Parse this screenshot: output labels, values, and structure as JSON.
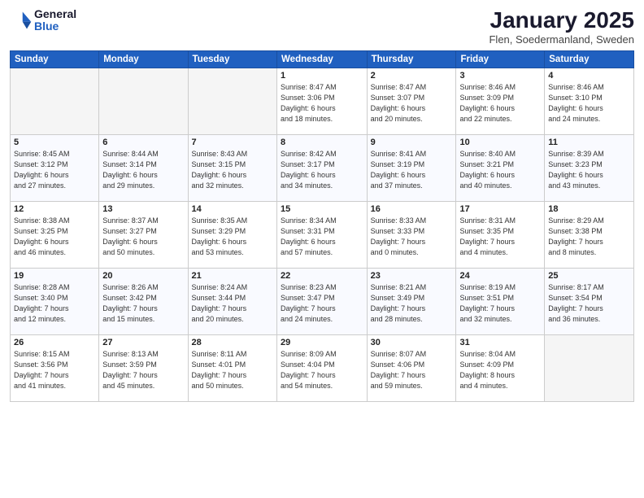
{
  "logo": {
    "general": "General",
    "blue": "Blue"
  },
  "title": "January 2025",
  "location": "Flen, Soedermanland, Sweden",
  "days_of_week": [
    "Sunday",
    "Monday",
    "Tuesday",
    "Wednesday",
    "Thursday",
    "Friday",
    "Saturday"
  ],
  "weeks": [
    [
      {
        "day": "",
        "info": ""
      },
      {
        "day": "",
        "info": ""
      },
      {
        "day": "",
        "info": ""
      },
      {
        "day": "1",
        "info": "Sunrise: 8:47 AM\nSunset: 3:06 PM\nDaylight: 6 hours\nand 18 minutes."
      },
      {
        "day": "2",
        "info": "Sunrise: 8:47 AM\nSunset: 3:07 PM\nDaylight: 6 hours\nand 20 minutes."
      },
      {
        "day": "3",
        "info": "Sunrise: 8:46 AM\nSunset: 3:09 PM\nDaylight: 6 hours\nand 22 minutes."
      },
      {
        "day": "4",
        "info": "Sunrise: 8:46 AM\nSunset: 3:10 PM\nDaylight: 6 hours\nand 24 minutes."
      }
    ],
    [
      {
        "day": "5",
        "info": "Sunrise: 8:45 AM\nSunset: 3:12 PM\nDaylight: 6 hours\nand 27 minutes."
      },
      {
        "day": "6",
        "info": "Sunrise: 8:44 AM\nSunset: 3:14 PM\nDaylight: 6 hours\nand 29 minutes."
      },
      {
        "day": "7",
        "info": "Sunrise: 8:43 AM\nSunset: 3:15 PM\nDaylight: 6 hours\nand 32 minutes."
      },
      {
        "day": "8",
        "info": "Sunrise: 8:42 AM\nSunset: 3:17 PM\nDaylight: 6 hours\nand 34 minutes."
      },
      {
        "day": "9",
        "info": "Sunrise: 8:41 AM\nSunset: 3:19 PM\nDaylight: 6 hours\nand 37 minutes."
      },
      {
        "day": "10",
        "info": "Sunrise: 8:40 AM\nSunset: 3:21 PM\nDaylight: 6 hours\nand 40 minutes."
      },
      {
        "day": "11",
        "info": "Sunrise: 8:39 AM\nSunset: 3:23 PM\nDaylight: 6 hours\nand 43 minutes."
      }
    ],
    [
      {
        "day": "12",
        "info": "Sunrise: 8:38 AM\nSunset: 3:25 PM\nDaylight: 6 hours\nand 46 minutes."
      },
      {
        "day": "13",
        "info": "Sunrise: 8:37 AM\nSunset: 3:27 PM\nDaylight: 6 hours\nand 50 minutes."
      },
      {
        "day": "14",
        "info": "Sunrise: 8:35 AM\nSunset: 3:29 PM\nDaylight: 6 hours\nand 53 minutes."
      },
      {
        "day": "15",
        "info": "Sunrise: 8:34 AM\nSunset: 3:31 PM\nDaylight: 6 hours\nand 57 minutes."
      },
      {
        "day": "16",
        "info": "Sunrise: 8:33 AM\nSunset: 3:33 PM\nDaylight: 7 hours\nand 0 minutes."
      },
      {
        "day": "17",
        "info": "Sunrise: 8:31 AM\nSunset: 3:35 PM\nDaylight: 7 hours\nand 4 minutes."
      },
      {
        "day": "18",
        "info": "Sunrise: 8:29 AM\nSunset: 3:38 PM\nDaylight: 7 hours\nand 8 minutes."
      }
    ],
    [
      {
        "day": "19",
        "info": "Sunrise: 8:28 AM\nSunset: 3:40 PM\nDaylight: 7 hours\nand 12 minutes."
      },
      {
        "day": "20",
        "info": "Sunrise: 8:26 AM\nSunset: 3:42 PM\nDaylight: 7 hours\nand 15 minutes."
      },
      {
        "day": "21",
        "info": "Sunrise: 8:24 AM\nSunset: 3:44 PM\nDaylight: 7 hours\nand 20 minutes."
      },
      {
        "day": "22",
        "info": "Sunrise: 8:23 AM\nSunset: 3:47 PM\nDaylight: 7 hours\nand 24 minutes."
      },
      {
        "day": "23",
        "info": "Sunrise: 8:21 AM\nSunset: 3:49 PM\nDaylight: 7 hours\nand 28 minutes."
      },
      {
        "day": "24",
        "info": "Sunrise: 8:19 AM\nSunset: 3:51 PM\nDaylight: 7 hours\nand 32 minutes."
      },
      {
        "day": "25",
        "info": "Sunrise: 8:17 AM\nSunset: 3:54 PM\nDaylight: 7 hours\nand 36 minutes."
      }
    ],
    [
      {
        "day": "26",
        "info": "Sunrise: 8:15 AM\nSunset: 3:56 PM\nDaylight: 7 hours\nand 41 minutes."
      },
      {
        "day": "27",
        "info": "Sunrise: 8:13 AM\nSunset: 3:59 PM\nDaylight: 7 hours\nand 45 minutes."
      },
      {
        "day": "28",
        "info": "Sunrise: 8:11 AM\nSunset: 4:01 PM\nDaylight: 7 hours\nand 50 minutes."
      },
      {
        "day": "29",
        "info": "Sunrise: 8:09 AM\nSunset: 4:04 PM\nDaylight: 7 hours\nand 54 minutes."
      },
      {
        "day": "30",
        "info": "Sunrise: 8:07 AM\nSunset: 4:06 PM\nDaylight: 7 hours\nand 59 minutes."
      },
      {
        "day": "31",
        "info": "Sunrise: 8:04 AM\nSunset: 4:09 PM\nDaylight: 8 hours\nand 4 minutes."
      },
      {
        "day": "",
        "info": ""
      }
    ]
  ]
}
